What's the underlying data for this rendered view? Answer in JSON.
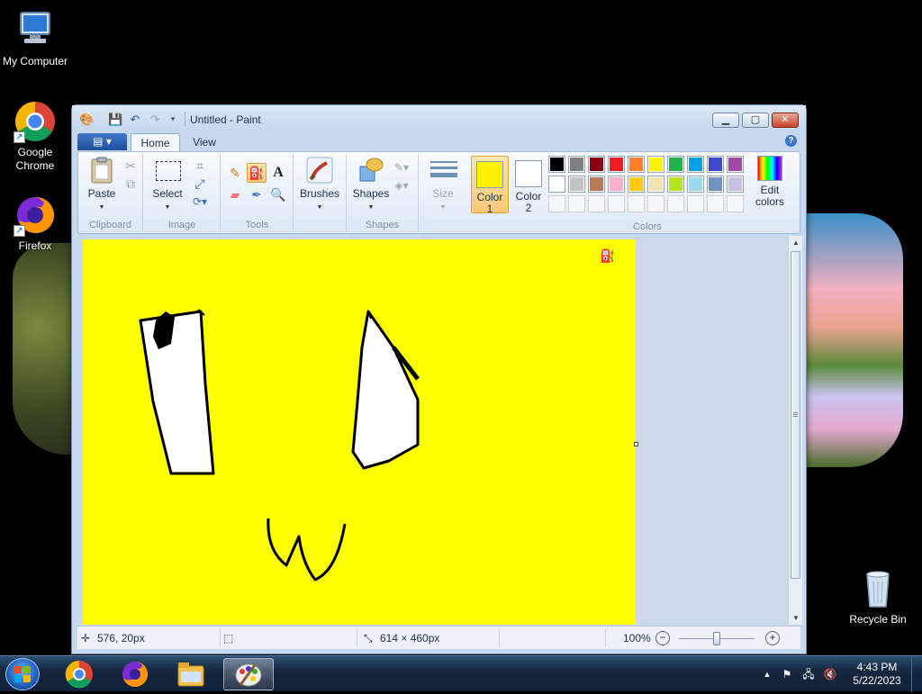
{
  "desktop": {
    "icons": [
      {
        "label": "My Computer",
        "icon": "computer-icon"
      },
      {
        "label": "Google Chrome",
        "icon": "chrome-icon"
      },
      {
        "label": "Firefox",
        "icon": "firefox-icon"
      },
      {
        "label": "Recycle Bin",
        "icon": "recycle-bin-icon"
      }
    ]
  },
  "window": {
    "title": "Untitled - Paint",
    "controls": {
      "minimize": "▁",
      "maximize": "▢",
      "close": "✕"
    }
  },
  "ribbon": {
    "tabs": [
      {
        "label": "Home",
        "active": true
      },
      {
        "label": "View",
        "active": false
      }
    ],
    "file_menu_glyph": "▤ ▾",
    "help_glyph": "?",
    "groups": {
      "clipboard": {
        "label": "Clipboard",
        "paste": "Paste"
      },
      "image": {
        "label": "Image",
        "select": "Select"
      },
      "tools": {
        "label": "Tools",
        "active_tool": "fill-icon"
      },
      "brushes": {
        "label": "Brushes"
      },
      "shapes": {
        "label": "Shapes",
        "button": "Shapes"
      },
      "size": {
        "label": "Size"
      },
      "colors": {
        "label": "Colors",
        "color1_label": "Color 1",
        "color2_label": "Color 2",
        "color1": "#FFF200",
        "color2": "#FFFFFF",
        "edit_colors": "Edit colors",
        "palette_row1": [
          "#000000",
          "#7F7F7F",
          "#880015",
          "#ED1C24",
          "#FF7F27",
          "#FFF200",
          "#22B14C",
          "#00A2E8",
          "#3F48CC",
          "#A349A4"
        ],
        "palette_row2": [
          "#FFFFFF",
          "#C3C3C3",
          "#B97A57",
          "#FFAEC9",
          "#FFC90E",
          "#EFE4B0",
          "#B5E61D",
          "#99D9EA",
          "#7092BE",
          "#C8BFE7"
        ]
      }
    }
  },
  "canvas": {
    "background": "#FFFF00",
    "cursor_icon": "fill-bucket-cursor-icon"
  },
  "status": {
    "cursor_pos": "576, 20px",
    "canvas_size": "614 × 460px",
    "zoom": "100%"
  },
  "taskbar": {
    "time": "4:43 PM",
    "date": "5/22/2023",
    "pinned": [
      "chrome-icon",
      "firefox-icon",
      "explorer-icon",
      "paint-icon"
    ]
  }
}
